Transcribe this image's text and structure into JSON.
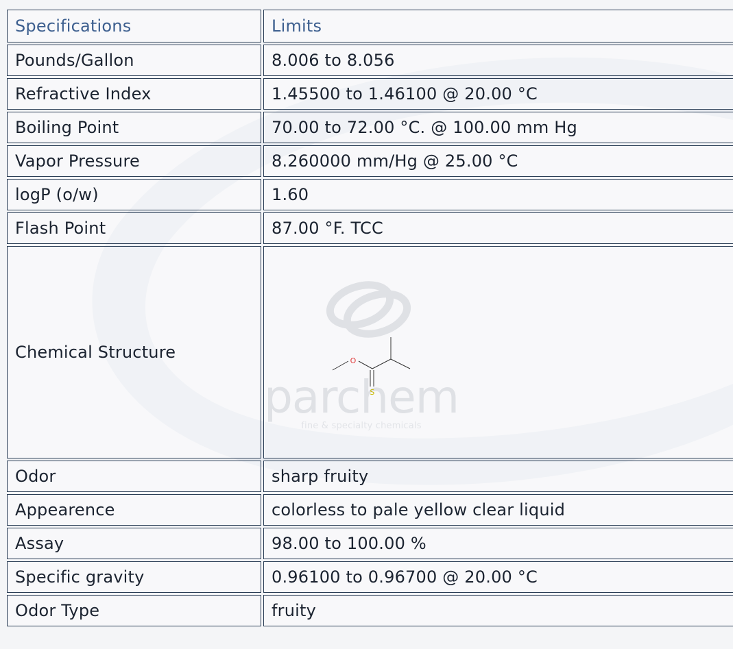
{
  "table": {
    "header": {
      "col1": "Specifications",
      "col2": "Limits"
    },
    "rows_before": [
      {
        "label": "Pounds/Gallon",
        "value": "8.006 to 8.056"
      },
      {
        "label": "Refractive Index",
        "value": "1.45500 to 1.46100 @ 20.00 °C"
      },
      {
        "label": "Boiling Point",
        "value": "70.00 to 72.00 °C. @ 100.00 mm Hg"
      },
      {
        "label": "Vapor Pressure",
        "value": "8.260000 mm/Hg @ 25.00 °C"
      },
      {
        "label": "logP (o/w)",
        "value": "1.60"
      },
      {
        "label": "Flash Point",
        "value": "87.00 °F. TCC"
      }
    ],
    "structure_row": {
      "label": "Chemical Structure",
      "atom_o": "O",
      "atom_s": "S",
      "watermark_brand": "parchem",
      "watermark_tagline": "fine & specialty chemicals"
    },
    "rows_after": [
      {
        "label": "Odor",
        "value": "sharp fruity"
      },
      {
        "label": "Appearence",
        "value": "colorless to pale yellow clear liquid"
      },
      {
        "label": "Assay",
        "value": "98.00 to 100.00 %"
      },
      {
        "label": "Specific gravity",
        "value": "0.96100 to 0.96700 @ 20.00 °C"
      },
      {
        "label": "Odor Type",
        "value": "fruity"
      }
    ]
  },
  "colors": {
    "border": "#2a3d55",
    "header_text": "#3d5f8f",
    "body_text": "#1b2330",
    "atom_o": "#e03a3a",
    "atom_s": "#c9b800"
  }
}
